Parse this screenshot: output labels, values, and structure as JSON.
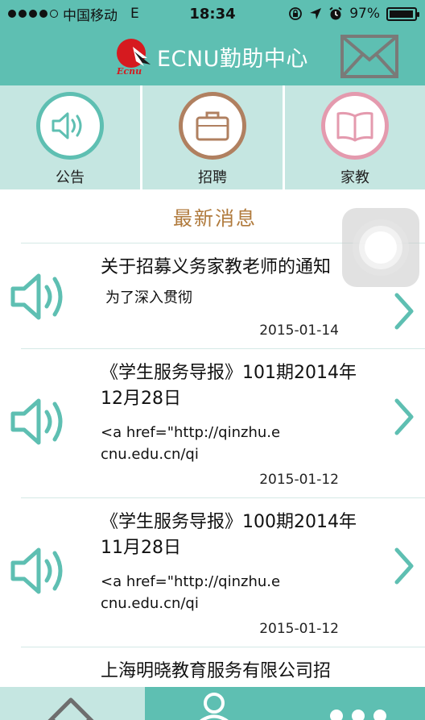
{
  "status_bar": {
    "carrier": "中国移动",
    "network": "E",
    "time": "18:34",
    "battery_percent": "97%",
    "battery_level": 0.97,
    "signal_bars": 4
  },
  "header": {
    "logo_text": "Ecnu",
    "title": "ECNU勤助中心",
    "mail_icon": "mail-icon"
  },
  "categories": [
    {
      "label": "公告",
      "icon": "speaker-icon",
      "color": "#5ebfb2"
    },
    {
      "label": "招聘",
      "icon": "briefcase-icon",
      "color": "#b08060"
    },
    {
      "label": "家教",
      "icon": "book-icon",
      "color": "#e49aae"
    }
  ],
  "news": {
    "title": "最新消息",
    "items": [
      {
        "title": "关于招募义务家教老师的通知",
        "summary": "为了深入贯彻",
        "date": "2015-01-14"
      },
      {
        "title": "《学生服务导报》101期2014年12月28日",
        "summary": "<a href=\"http://qinzhu.ecnu.edu.cn/qi",
        "date": "2015-01-12"
      },
      {
        "title": "《学生服务导报》100期2014年11月28日",
        "summary": "<a href=\"http://qinzhu.ecnu.edu.cn/qi",
        "date": "2015-01-12"
      },
      {
        "title": "上海明晓教育服务有限公司招",
        "summary": "",
        "date": ""
      }
    ]
  },
  "tab_bar": {
    "tabs": [
      {
        "icon": "home-icon",
        "active": false
      },
      {
        "icon": "user-icon",
        "active": true
      },
      {
        "icon": "more-icon",
        "active": false
      }
    ]
  },
  "colors": {
    "accent": "#5ebfb2",
    "category_bg": "#c5e6e1",
    "news_title": "#b07a3c"
  }
}
